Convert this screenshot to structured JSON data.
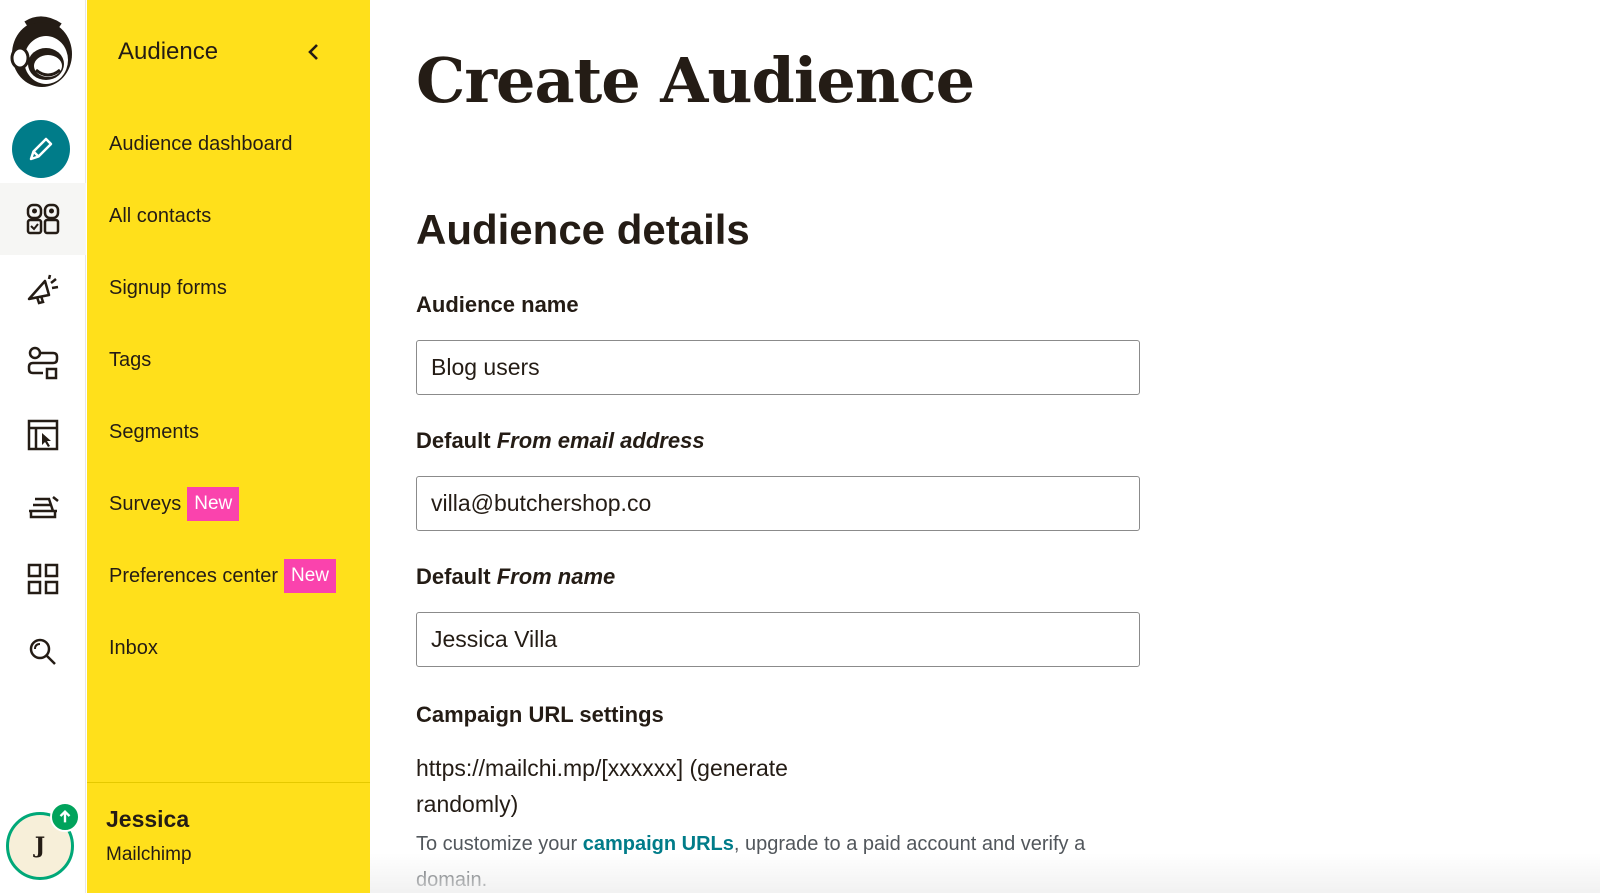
{
  "nav": {
    "header": "Audience",
    "items": [
      {
        "label": "Audience dashboard"
      },
      {
        "label": "All contacts"
      },
      {
        "label": "Signup forms"
      },
      {
        "label": "Tags"
      },
      {
        "label": "Segments"
      },
      {
        "label": "Surveys",
        "badge": "New"
      },
      {
        "label": "Preferences center",
        "badge": "New"
      },
      {
        "label": "Inbox"
      }
    ],
    "user": {
      "name": "Jessica",
      "org": "Mailchimp",
      "initial": "J"
    }
  },
  "rail": {
    "icons": [
      "mailchimp-logo",
      "pencil-icon",
      "audience-icon",
      "campaigns-icon",
      "automations-icon",
      "website-icon",
      "integrations-icon",
      "apps-icon",
      "search-icon"
    ]
  },
  "page": {
    "title": "Create Audience",
    "section_title": "Audience details",
    "fields": {
      "audience_name": {
        "label": "Audience name",
        "value": "Blog users"
      },
      "from_email": {
        "label_prefix": "Default ",
        "label_em": "From email address",
        "value": "villa@butchershop.co"
      },
      "from_name": {
        "label_prefix": "Default ",
        "label_em": "From name",
        "value": "Jessica Villa"
      }
    },
    "campaign_url": {
      "label": "Campaign URL settings",
      "url_text": "https://mailchi.mp/[xxxxxx] (generate randomly)",
      "help_prefix": "To customize your ",
      "help_link": "campaign URLs",
      "help_suffix": ", upgrade to a paid account and verify a domain."
    }
  },
  "colors": {
    "nav_bg": "#ffe01b",
    "accent_teal": "#007c89",
    "badge_pink": "#fa43ad",
    "upgrade_green": "#00a35c"
  }
}
